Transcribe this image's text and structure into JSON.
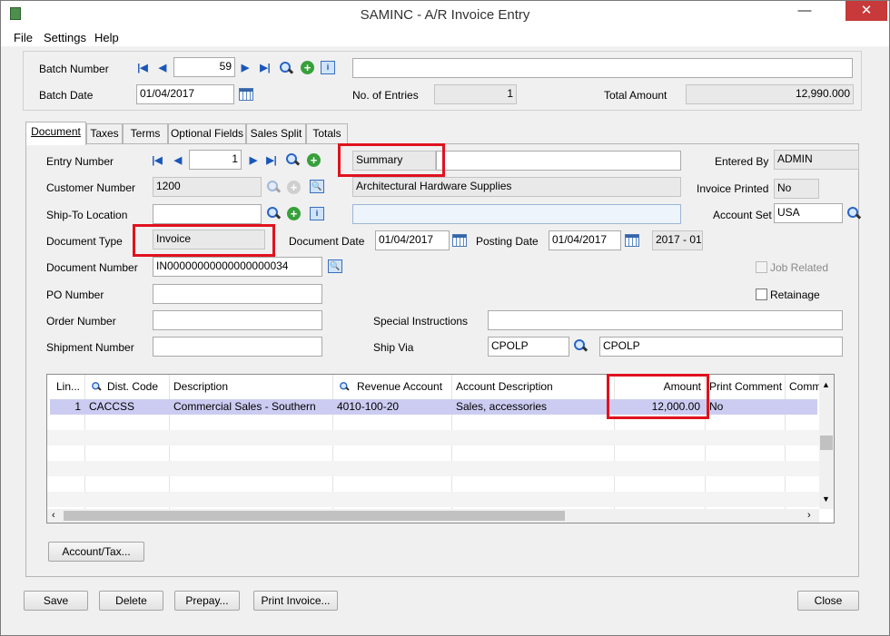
{
  "window": {
    "title": "SAMINC - A/R Invoice Entry",
    "minimize": "—",
    "close": "✕"
  },
  "menu": [
    "File",
    "Settings",
    "Help"
  ],
  "batch": {
    "number_label": "Batch Number",
    "number_value": "59",
    "description_value": "",
    "date_label": "Batch Date",
    "date_value": "01/04/2017",
    "entries_label": "No. of Entries",
    "entries_value": "1",
    "total_label": "Total Amount",
    "total_value": "12,990.000"
  },
  "tabs": [
    "Document",
    "Taxes",
    "Terms",
    "Optional Fields",
    "Sales Split",
    "Totals"
  ],
  "document": {
    "entry_number_label": "Entry Number",
    "entry_number_value": "1",
    "entry_description": "Summary",
    "entered_by_label": "Entered By",
    "entered_by_value": "ADMIN",
    "customer_number_label": "Customer Number",
    "customer_number_value": "1200",
    "customer_name": "Architectural Hardware Supplies",
    "invoice_printed_label": "Invoice Printed",
    "invoice_printed_value": "No",
    "ship_to_label": "Ship-To Location",
    "ship_to_value": "",
    "ship_to_description": "",
    "account_set_label": "Account Set",
    "account_set_value": "USA",
    "document_type_label": "Document Type",
    "document_type_value": "Invoice",
    "document_date_label": "Document Date",
    "document_date_value": "01/04/2017",
    "posting_date_label": "Posting Date",
    "posting_date_value": "01/04/2017",
    "fiscal_period": "2017 - 01",
    "document_number_label": "Document Number",
    "document_number_value": "IN00000000000000000034",
    "job_related_label": "Job Related",
    "po_number_label": "PO Number",
    "retainage_label": "Retainage",
    "order_number_label": "Order Number",
    "special_instructions_label": "Special Instructions",
    "shipment_number_label": "Shipment Number",
    "ship_via_label": "Ship Via",
    "ship_via_code": "CPOLP",
    "ship_via_name": "CPOLP"
  },
  "grid": {
    "columns": [
      "Lin...",
      "Dist. Code",
      "Description",
      "Revenue Account",
      "Account Description",
      "Amount",
      "Print Comment",
      "Comme"
    ],
    "rows": [
      {
        "line": "1",
        "dist_code": "CACCSS",
        "description": "Commercial Sales - Southern",
        "revenue_account": "4010-100-20",
        "account_description": "Sales, accessories",
        "amount": "12,000.00",
        "print_comment": "No",
        "comment": ""
      }
    ]
  },
  "buttons": {
    "account_tax": "Account/Tax...",
    "save": "Save",
    "delete": "Delete",
    "prepay": "Prepay...",
    "print_invoice": "Print Invoice...",
    "close": "Close"
  },
  "colors": {
    "highlight_box": "#e0121e",
    "selected_row": "#ccccf2",
    "window_bg": "#f0f0f0"
  }
}
